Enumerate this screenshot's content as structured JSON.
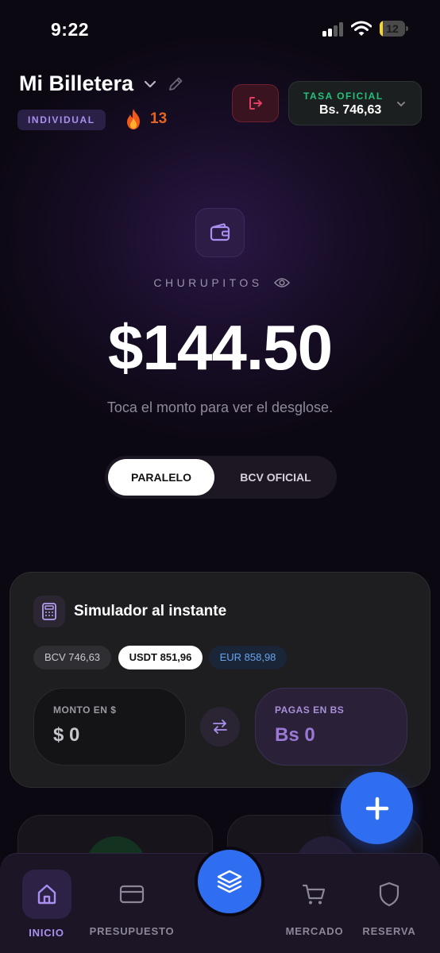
{
  "status_bar": {
    "time": "9:22",
    "battery_level": 12,
    "battery_label": "12"
  },
  "header": {
    "wallet_name": "Mi Billetera",
    "wallet_type_badge": "INDIVIDUAL",
    "streak_count": "13",
    "rate_label": "TASA OFICIAL",
    "rate_value": "Bs. 746,63"
  },
  "hero": {
    "account_name": "CHURUPITOS",
    "balance": "$144.50",
    "hint": "Toca el monto para ver el desglose.",
    "toggle_options": [
      "PARALELO",
      "BCV OFICIAL"
    ],
    "toggle_selected": "PARALELO"
  },
  "simulator": {
    "title": "Simulador al instante",
    "chips": [
      "BCV 746,63",
      "USDT 851,96",
      "EUR 858,98"
    ],
    "chip_selected": "USDT 851,96",
    "usd_label": "MONTO EN $",
    "usd_value": "$ 0",
    "bs_label": "PAGAS EN BS",
    "bs_value": "Bs 0"
  },
  "bottom_nav": {
    "items": [
      {
        "label": "INICIO",
        "icon": "home-icon"
      },
      {
        "label": "PRESUPUESTO",
        "icon": "card-icon"
      },
      {
        "label": "",
        "icon": "layers-icon"
      },
      {
        "label": "MERCADO",
        "icon": "cart-icon"
      },
      {
        "label": "RESERVA",
        "icon": "shield-icon"
      }
    ],
    "active": "INICIO"
  },
  "colors": {
    "accent_purple": "#a98ff0",
    "accent_blue": "#2f6ef0",
    "rate_green": "#22c07a",
    "streak_orange": "#e4651f",
    "logout_red": "#e0405f"
  }
}
